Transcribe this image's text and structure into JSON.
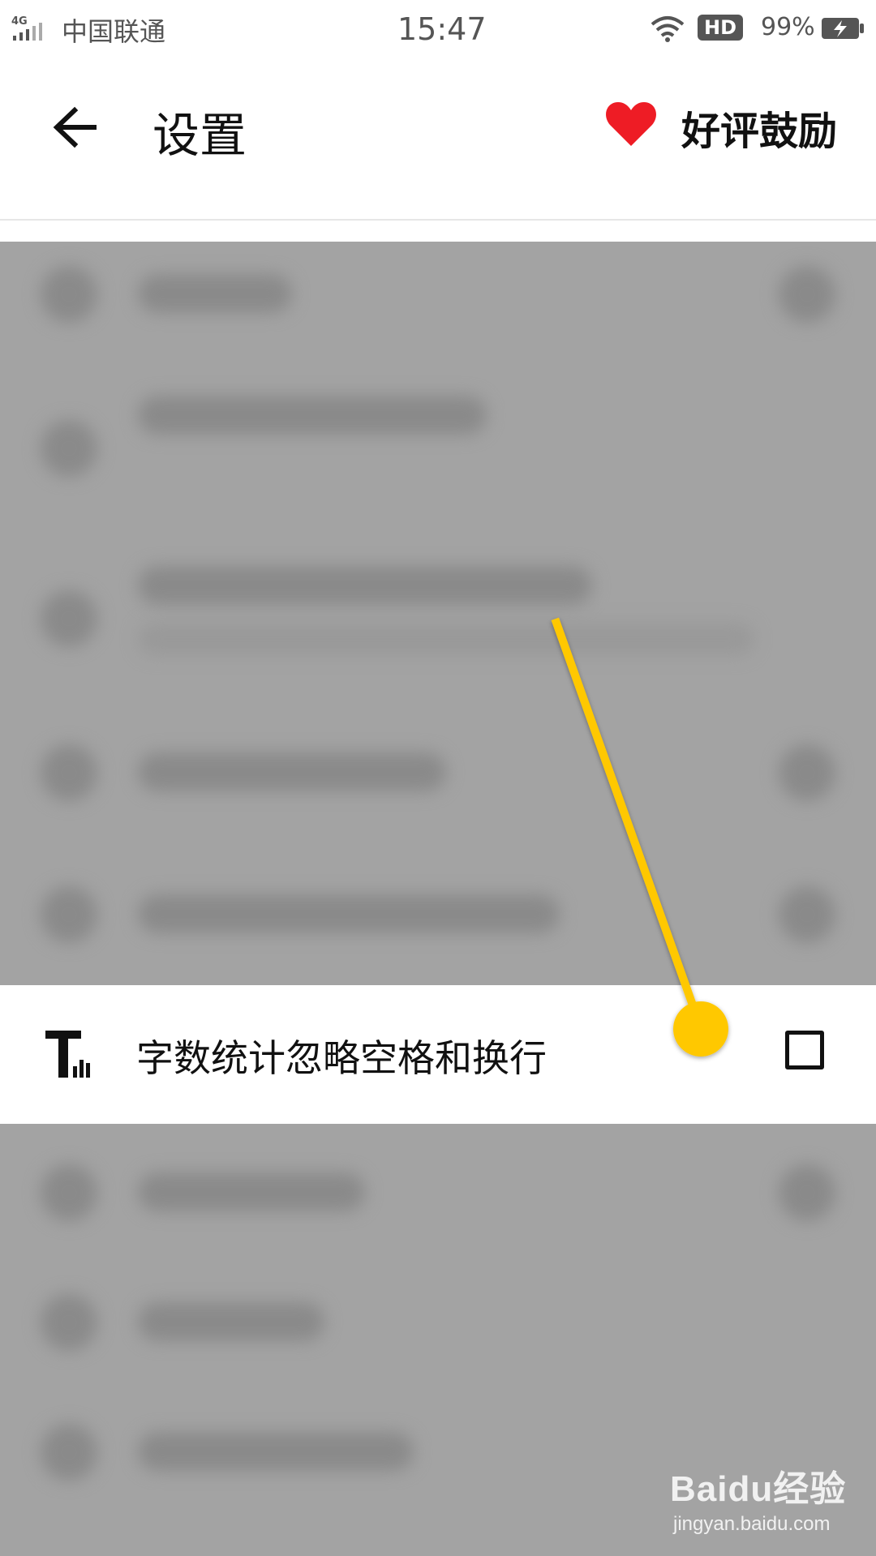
{
  "status_bar": {
    "network": "4G",
    "carrier": "中国联通",
    "time": "15:47",
    "hd_badge": "HD",
    "battery_percent": "99%",
    "battery_level": 0.99,
    "icons": [
      "signal-icon",
      "wifi-icon",
      "battery-charging-icon"
    ]
  },
  "header": {
    "title": "设置",
    "praise_label": "好评鼓励",
    "back_icon": "arrow-left-icon",
    "praise_icon": "heart-icon",
    "heart_color": "#ee1c25"
  },
  "settings": {
    "highlighted_item": {
      "label": "字数统计忽略空格和换行",
      "icon": "text-count-icon",
      "checked": false
    }
  },
  "annotation": {
    "color": "#ffc800"
  },
  "watermark": {
    "brand": "Baidu经验",
    "url": "jingyan.baidu.com"
  }
}
